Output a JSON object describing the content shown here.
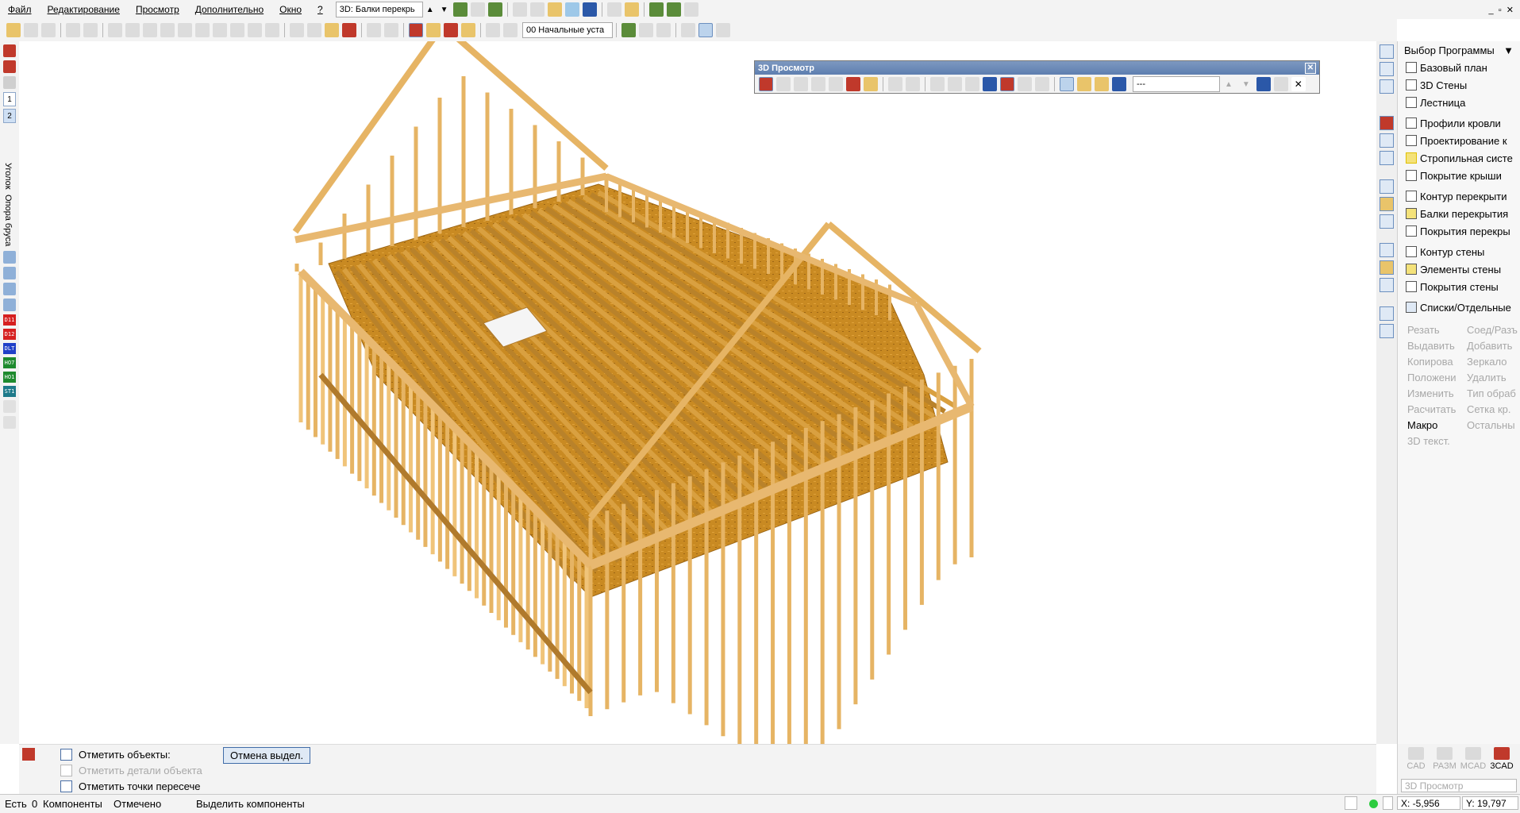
{
  "menubar": {
    "items": [
      "Файл",
      "Редактирование",
      "Просмотр",
      "Дополнительно",
      "Окно",
      "?"
    ],
    "view_combo": "3D: Балки перекрь"
  },
  "toolbar2": {
    "layer_combo": "00 Начальные уста"
  },
  "left_toolbar": {
    "numbers": [
      "1",
      "2"
    ],
    "vertical_labels": [
      "Уголок",
      "Опора бруса"
    ],
    "tags": [
      "D11",
      "D12",
      "DLT",
      "HO7",
      "HO1",
      "ST1"
    ]
  },
  "view3d": {
    "title": "3D Просмотр",
    "close": "✕",
    "combo_value": "---"
  },
  "right_panel": {
    "program_select": "Выбор Программы",
    "items": [
      "Базовый план",
      "3D Стены",
      "Лестница",
      "Профили кровли",
      "Проектирование к",
      "Стропильная систе",
      "Покрытие крыши",
      "Контур перекрыти",
      "Балки перекрытия",
      "Покрытия перекры",
      "Контур стены",
      "Элементы стены",
      "Покрытия стены",
      "Списки/Отдельные"
    ],
    "commands": [
      "Резать",
      "Соед/Разъ",
      "Выдавить",
      "Добавить",
      "Копирова",
      "Зеркало",
      "Положени",
      "Удалить",
      "Изменить",
      "Тип обраб",
      "Расчитать",
      "Сетка кр.",
      "Макро",
      "Остальны",
      "3D текст."
    ],
    "active_commands": [
      "Макро"
    ]
  },
  "bottom_panel": {
    "options": [
      {
        "label": "Отметить объекты:",
        "enabled": true
      },
      {
        "label": "Отметить детали объекта",
        "enabled": false
      },
      {
        "label": "Отметить точки пересече",
        "enabled": true
      }
    ],
    "cancel_button": "Отмена выдел."
  },
  "modes": {
    "items": [
      "CAD",
      "РАЗМ",
      "MCAD",
      "3CAD"
    ],
    "active": "3CAD",
    "view_field": "3D Просмотр"
  },
  "statusbar": {
    "left": "Есть",
    "count": "0",
    "components": "Компоненты",
    "marked": "Отмечено",
    "hint": "Выделить компоненты",
    "x": "X: -5,956",
    "y": "Y: 19,797"
  },
  "colors": {
    "wood": "#e6b464",
    "wood_dark": "#b07a2c",
    "osb": "#c98a22",
    "accent": "#5e7fb0"
  }
}
